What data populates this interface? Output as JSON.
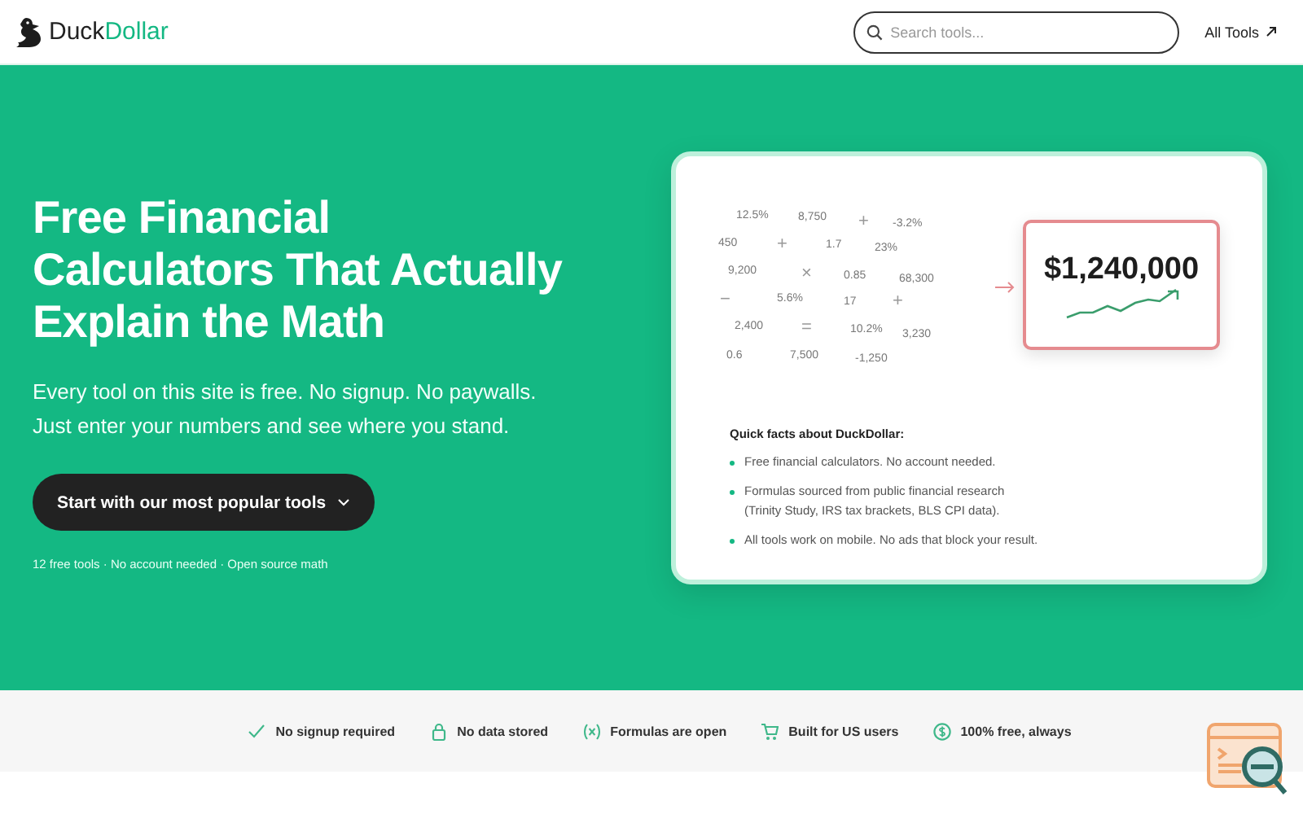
{
  "header": {
    "brand_first": "Duck",
    "brand_second": "Dollar",
    "search": {
      "placeholder": "Search tools..."
    },
    "nav_link": "All Tools"
  },
  "hero": {
    "title": "Free Financial Calculators That Actually Explain the Math",
    "subtitle": [
      "Every tool on this site is free. No signup. No paywalls.",
      "Just enter your numbers and see where you stand."
    ],
    "cta": "Start with our most popular tools",
    "meta": "12 free tools · No account needed · Open source math"
  },
  "card": {
    "tokens": [
      {
        "text": "12.5%",
        "kind": "number"
      },
      {
        "text": "8,750",
        "kind": "number"
      },
      {
        "text": "+",
        "kind": "operator"
      },
      {
        "text": "-3.2%",
        "kind": "number"
      },
      {
        "text": "450",
        "kind": "number"
      },
      {
        "text": "+",
        "kind": "operator"
      },
      {
        "text": "1.7",
        "kind": "number"
      },
      {
        "text": "23%",
        "kind": "number"
      },
      {
        "text": "9,200",
        "kind": "number"
      },
      {
        "text": "×",
        "kind": "operator"
      },
      {
        "text": "0.85",
        "kind": "number"
      },
      {
        "text": "68,300",
        "kind": "number"
      },
      {
        "text": "−",
        "kind": "operator"
      },
      {
        "text": "5.6%",
        "kind": "number"
      },
      {
        "text": "17",
        "kind": "number"
      },
      {
        "text": "+",
        "kind": "operator"
      },
      {
        "text": "2,400",
        "kind": "number"
      },
      {
        "text": "=",
        "kind": "operator"
      },
      {
        "text": "10.2%",
        "kind": "number"
      },
      {
        "text": "3,230",
        "kind": "number"
      },
      {
        "text": "0.6",
        "kind": "number"
      },
      {
        "text": "7,500",
        "kind": "number"
      },
      {
        "text": "-1,250",
        "kind": "number"
      }
    ],
    "result": "$1,240,000",
    "facts_title": "Quick facts about DuckDollar:",
    "facts": [
      "Free financial calculators. No account needed.",
      "Formulas sourced from public financial research\n(Trinity Study, IRS tax brackets, BLS CPI data).",
      "All tools work on mobile. No ads that block your result."
    ]
  },
  "features": [
    {
      "label": "No signup required",
      "kind": "check"
    },
    {
      "label": "No data stored",
      "kind": "lock"
    },
    {
      "label": "Formulas are open",
      "kind": "formula"
    },
    {
      "label": "Built for US users",
      "kind": "cart"
    },
    {
      "label": "100% free, always",
      "kind": "dollar"
    }
  ]
}
